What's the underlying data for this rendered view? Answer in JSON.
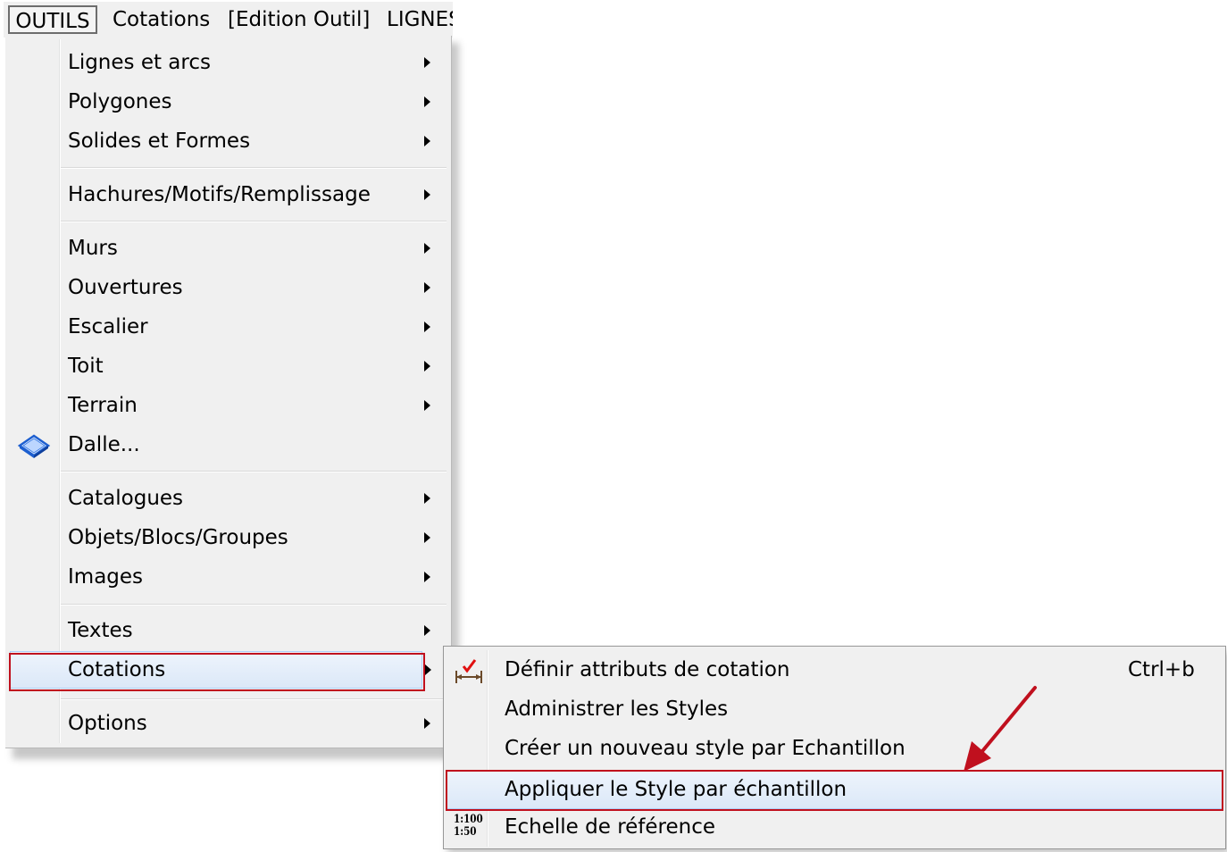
{
  "menubar": {
    "items": [
      "OUTILS",
      "Cotations",
      "[Edition Outil]",
      "LIGNES"
    ]
  },
  "main_menu": {
    "items": [
      {
        "label": "Lignes et arcs",
        "submenu": true
      },
      {
        "label": "Polygones",
        "submenu": true
      },
      {
        "label": "Solides et Formes",
        "submenu": true
      },
      {
        "label": "Hachures/Motifs/Remplissage",
        "submenu": true
      },
      {
        "label": "Murs",
        "submenu": true
      },
      {
        "label": "Ouvertures",
        "submenu": true
      },
      {
        "label": "Escalier",
        "submenu": true
      },
      {
        "label": "Toit",
        "submenu": true
      },
      {
        "label": "Terrain",
        "submenu": true
      },
      {
        "label": "Dalle...",
        "submenu": false,
        "icon": "slab-icon"
      },
      {
        "label": "Catalogues",
        "submenu": true
      },
      {
        "label": "Objets/Blocs/Groupes",
        "submenu": true
      },
      {
        "label": "Images",
        "submenu": true
      },
      {
        "label": "Textes",
        "submenu": true
      },
      {
        "label": "Cotations",
        "submenu": true,
        "highlighted": true
      },
      {
        "label": "Options",
        "submenu": true
      }
    ]
  },
  "sub_menu": {
    "items": [
      {
        "label": "Définir attributs de cotation",
        "shortcut": "Ctrl+b",
        "icon": "dimension-attributes-icon"
      },
      {
        "label": "Administrer les Styles"
      },
      {
        "label": "Créer un nouveau style par Echantillon"
      },
      {
        "label": "Appliquer le Style par échantillon",
        "highlighted": true
      },
      {
        "label": "Echelle de référence",
        "icon": "scale-icon",
        "icon_text": [
          "1:100",
          "1:50"
        ]
      }
    ]
  },
  "annotation_color": "#c0101e",
  "highlight_color": "#dbe8f8"
}
